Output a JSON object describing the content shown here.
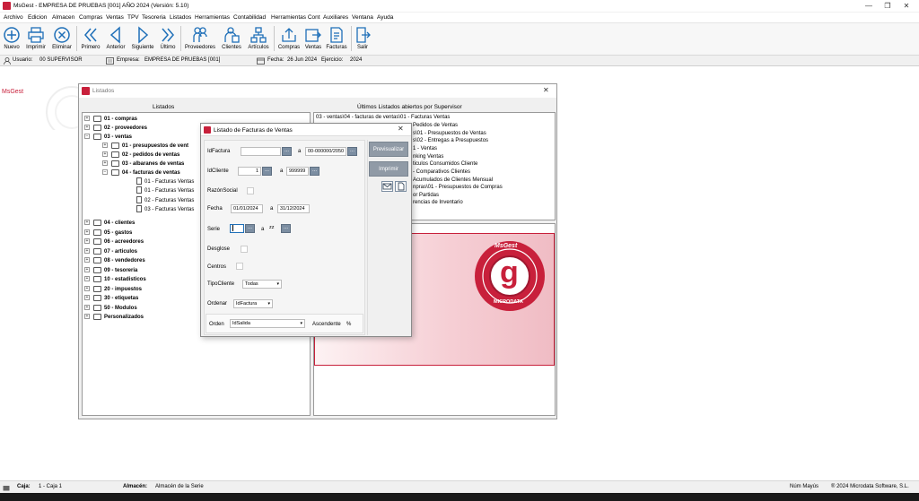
{
  "window": {
    "title": "MsGest - EMPRESA DE PRUEBAS  [001] AÑO 2024     (Versión: 5.10)",
    "controls": {
      "minimize": "—",
      "maximize": "❐",
      "close": "✕"
    }
  },
  "menu": [
    "Archivo",
    "Edicion",
    "Almacen",
    "Compras",
    "Ventas",
    "TPV",
    "Tesoreria",
    "Listados",
    "Herramientas",
    "Contabilidad",
    "Herramientas Cont",
    "Auxiliares",
    "Ventana",
    "Ayuda"
  ],
  "toolbar": {
    "nuevo": "Nuevo",
    "imprimir": "Imprimir",
    "eliminar": "Eliminar",
    "primero": "Primero",
    "anterior": "Anterior",
    "siguiente": "Siguiente",
    "ultimo": "Último",
    "proveedores": "Proveedores",
    "clientes": "Clientes",
    "articulos": "Artículos",
    "compras": "Compras",
    "ventas": "Ventas",
    "facturas": "Facturas",
    "salir": "Salir"
  },
  "infobar": {
    "usuario_label": "Usuario:",
    "usuario": "00 SUPERVISOR",
    "empresa_label": "Empresa:",
    "empresa": "EMPRESA DE PRUEBAS  [001]",
    "fecha_label": "Fecha:",
    "fecha": "26 Jun 2024",
    "ejercicio_label": "Ejercicio:",
    "ejercicio": "2024"
  },
  "side_logo": "MsGest",
  "listados": {
    "title": "Listados",
    "close": "✕",
    "left_header": "Listados",
    "right_header": "Últimos Listados abiertos por Supervisor",
    "tree": {
      "compras": "01 - compras",
      "proveedores": "02 - proveedores",
      "ventas": "03 - ventas",
      "presupuestos": "01 - presupuestos de vent",
      "pedidos": "02 - pedidos de ventas",
      "albaranes": "03 - albaranes de ventas",
      "facturas": "04 - facturas de ventas",
      "fv1": "01 - Facturas Ventas",
      "fv2": "01 - Facturas Ventas",
      "fv3": "02 - Facturas Ventas",
      "fv4": "03 - Facturas Ventas",
      "clientes": "04 - clientes",
      "gastos": "05 - gastos",
      "acreedores": "06 - acreedores",
      "articulos": "07 - articulos",
      "vendedores": "08 - vendedores",
      "tesoreria": "09 - tesoreria",
      "estadisticos": "10 - estadisticos",
      "impuestos": "20 - impuestos",
      "etiquetas": "30 - etiquetas",
      "modulos": "50 - Modulos",
      "personalizados": "Personalizados"
    },
    "recent": [
      "03 - ventas\\04 - facturas de ventas\\01 - Facturas Ventas",
      "Pedidos de Ventas",
      "s\\01 - Presupuestos de Ventas",
      "s\\02 - Entregas a Presupuestos",
      "1 - Ventas",
      "nking Ventas",
      "ticulos Consumidos Cliente",
      "- Comparativos Clientes",
      "Acumulados de Clientes Mensual",
      "npras\\01 - Presupuestos de Compras",
      "or Partidas",
      "rencias de Inventario"
    ],
    "logo_top": "MsGest",
    "logo_bottom": "MICRODATA",
    "logo_letter": "g"
  },
  "dialog": {
    "title": "Listado de Facturas de Ventas",
    "close": "✕",
    "idfactura_label": "IdFactura",
    "a": "a",
    "idfactura_to": "00-000000/2050",
    "idcliente_label": "IdCliente",
    "idcliente_from": "1",
    "idcliente_to": "999999",
    "razon_label": "RazónSocial",
    "fecha_label": "Fecha",
    "fecha_from": "01/01/2024",
    "fecha_to": "31/12/2024",
    "serie_label": "Serie",
    "serie_to": "zz",
    "desglose_label": "Desglose",
    "centros_label": "Centros",
    "tipocliente_label": "TipoCliente",
    "tipocliente": "Todas",
    "ordenar_label": "Ordenar",
    "ordenar": "IdFactura",
    "orden_label": "Orden",
    "orden": "IdSalida",
    "ascendente_label": "Ascendente",
    "percent": "%",
    "dots": "...",
    "previsualizar": "Previsualizar",
    "imprimir": "Imprimir"
  },
  "status": {
    "caja_label": "Caja:",
    "caja": "1 - Caja 1",
    "almacen_label": "Almacén:",
    "almacen": "Almacén de la Serie",
    "keys": "Núm  Mayús",
    "copyright": "® 2024 Microdata Software, S.L."
  },
  "colors": {
    "brand": "#c8203b",
    "accent": "#1e6fb8",
    "button": "#7c8ea2"
  }
}
